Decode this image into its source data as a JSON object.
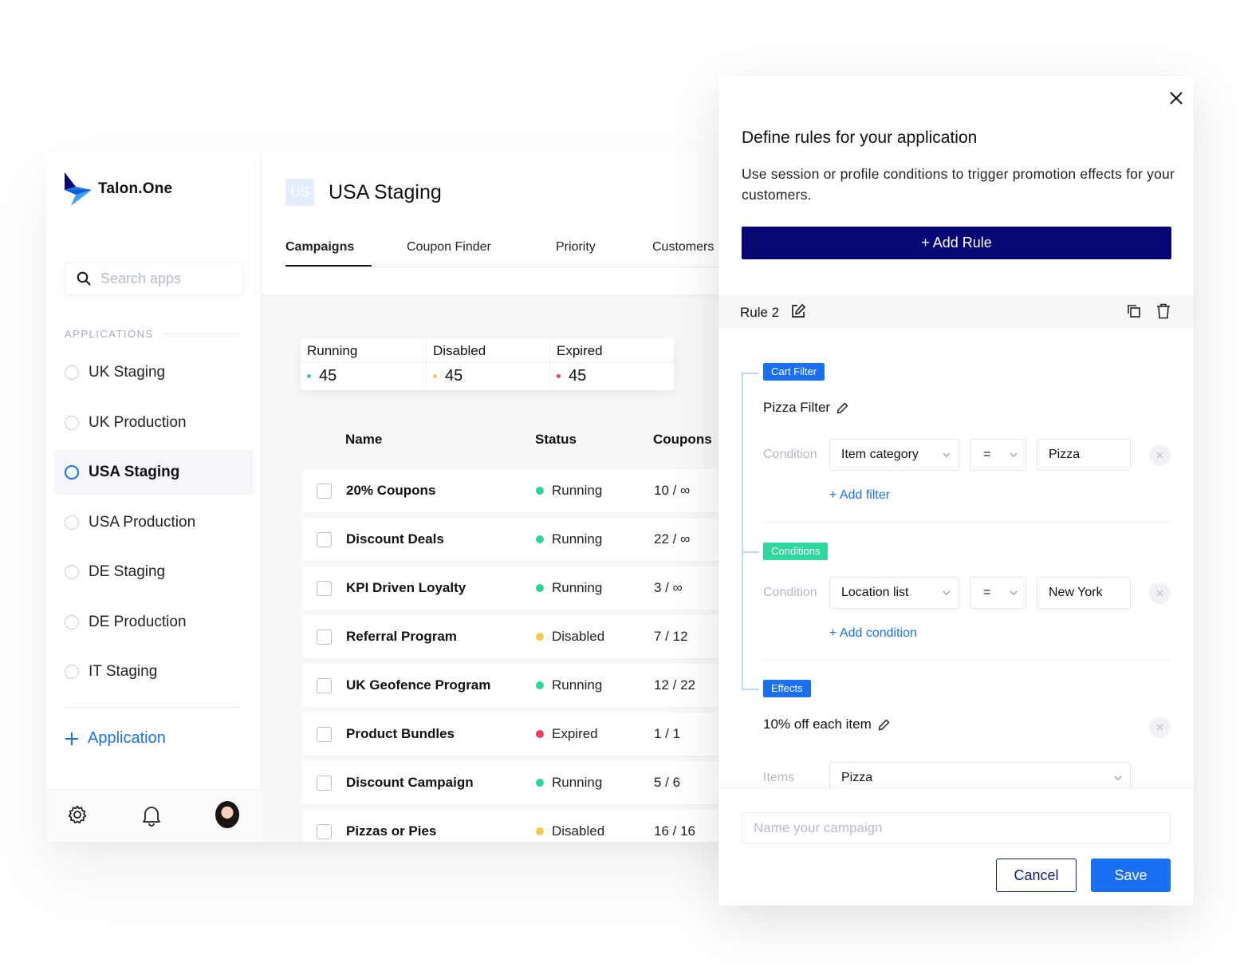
{
  "brand": {
    "name": "Talon.One",
    "accent": "#1a73e8",
    "dark": "#060674"
  },
  "sidebar": {
    "search_placeholder": "Search apps",
    "section_label": "APPLICATIONS",
    "items": [
      {
        "label": "UK Staging",
        "active": false
      },
      {
        "label": "UK Production",
        "active": false
      },
      {
        "label": "USA Staging",
        "active": true
      },
      {
        "label": "USA Production",
        "active": false
      },
      {
        "label": "DE Staging",
        "active": false
      },
      {
        "label": "DE Production",
        "active": false
      },
      {
        "label": "IT Staging",
        "active": false
      }
    ],
    "add_label": "Application",
    "footer_icons": [
      "settings-icon",
      "bell-icon",
      "avatar"
    ]
  },
  "header": {
    "badge": "US",
    "title": "USA Staging",
    "tabs": [
      {
        "label": "Campaigns",
        "active": true
      },
      {
        "label": "Coupon Finder",
        "active": false
      },
      {
        "label": "Priority",
        "active": false
      },
      {
        "label": "Customers",
        "active": false
      }
    ]
  },
  "stats": [
    {
      "label": "Running",
      "value": "45",
      "color": "#2bd49a"
    },
    {
      "label": "Disabled",
      "value": "45",
      "color": "#f7c948"
    },
    {
      "label": "Expired",
      "value": "45",
      "color": "#ee3d5b"
    }
  ],
  "table": {
    "columns": [
      "Name",
      "Status",
      "Coupons"
    ],
    "status_colors": {
      "Running": "#2bd49a",
      "Disabled": "#f7c948",
      "Expired": "#ee3d5b"
    },
    "rows": [
      {
        "name": "20% Coupons",
        "status": "Running",
        "coupons": "10 / ∞"
      },
      {
        "name": "Discount Deals",
        "status": "Running",
        "coupons": "22 / ∞"
      },
      {
        "name": "KPI Driven Loyalty",
        "status": "Running",
        "coupons": "3 / ∞"
      },
      {
        "name": "Referral Program",
        "status": "Disabled",
        "coupons": "7 / 12"
      },
      {
        "name": "UK Geofence Program",
        "status": "Running",
        "coupons": "12 / 22"
      },
      {
        "name": "Product Bundles",
        "status": "Expired",
        "coupons": "1 / 1"
      },
      {
        "name": "Discount Campaign",
        "status": "Running",
        "coupons": "5 / 6"
      },
      {
        "name": "Pizzas or Pies",
        "status": "Disabled",
        "coupons": "16 / 16"
      }
    ]
  },
  "panel": {
    "title": "Define rules for your application",
    "description": "Use session or profile conditions to trigger promotion effects for your customers.",
    "add_rule": "+ Add Rule",
    "rule_name": "Rule 2",
    "cart_filter": {
      "tag": "Cart Filter",
      "tag_color": "#1a6ff3",
      "title": "Pizza Filter",
      "label": "Condition",
      "field": "Item category",
      "operator": "=",
      "value": "Pizza",
      "add_link": "+ Add filter"
    },
    "conditions": {
      "tag": "Conditions",
      "tag_color": "#2fd6a0",
      "label": "Condition",
      "field": "Location list",
      "operator": "=",
      "value": "New York",
      "add_link": "+ Add condition"
    },
    "effects": {
      "tag": "Effects",
      "tag_color": "#1a6ff3",
      "title": "10% off each item",
      "label": "Items",
      "value": "Pizza"
    },
    "campaign_placeholder": "Name your campaign",
    "cancel": "Cancel",
    "save": "Save"
  }
}
